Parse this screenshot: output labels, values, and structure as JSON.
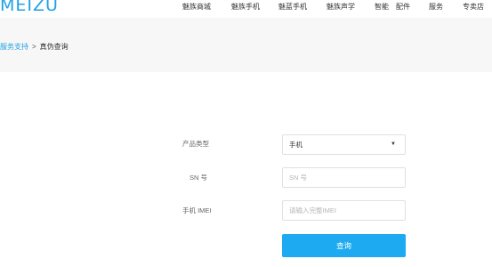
{
  "header": {
    "logo": "MEIZU",
    "nav": [
      "魅族商城",
      "魅族手机",
      "魅蓝手机",
      "魅族声学",
      "智能",
      "配件",
      "服务",
      "专卖店"
    ]
  },
  "breadcrumb": {
    "parent": "服务支持",
    "separator": ">",
    "current": "真伪查询"
  },
  "form": {
    "product_type": {
      "label": "产品类型",
      "value": "手机"
    },
    "sn": {
      "label": "SN 号",
      "placeholder": "SN 号"
    },
    "imei": {
      "label": "手机 IMEI",
      "placeholder": "请输入完整IMEI"
    },
    "submit_label": "查询"
  },
  "colors": {
    "accent": "#1eaaf0",
    "logo": "#1ea0e6"
  }
}
